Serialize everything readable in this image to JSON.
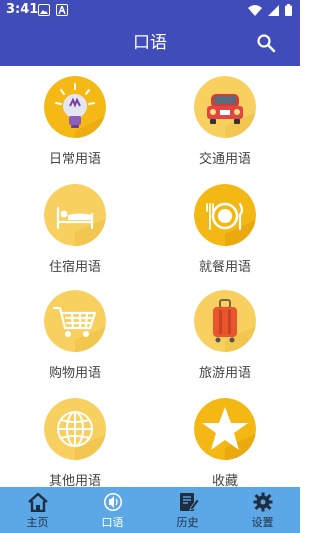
{
  "status": {
    "time": "3:41"
  },
  "header": {
    "title": "口语"
  },
  "categories": [
    {
      "label": "日常用语",
      "icon": "lightbulb-icon"
    },
    {
      "label": "交通用语",
      "icon": "car-icon"
    },
    {
      "label": "住宿用语",
      "icon": "bed-icon"
    },
    {
      "label": "就餐用语",
      "icon": "dining-icon"
    },
    {
      "label": "购物用语",
      "icon": "shopping-cart-icon"
    },
    {
      "label": "旅游用语",
      "icon": "suitcase-icon"
    },
    {
      "label": "其他用语",
      "icon": "globe-icon"
    },
    {
      "label": "收藏",
      "icon": "star-icon"
    }
  ],
  "bottom_nav": [
    {
      "label": "主页",
      "icon": "home-icon"
    },
    {
      "label": "口语",
      "icon": "speech-icon",
      "active": true
    },
    {
      "label": "历史",
      "icon": "notebook-icon"
    },
    {
      "label": "设置",
      "icon": "gear-icon"
    }
  ],
  "colors": {
    "primary": "#3f4cba",
    "nav_bg": "#5ca7e6",
    "circle_yellow": "#f7d060",
    "circle_orange": "#f4b814"
  }
}
